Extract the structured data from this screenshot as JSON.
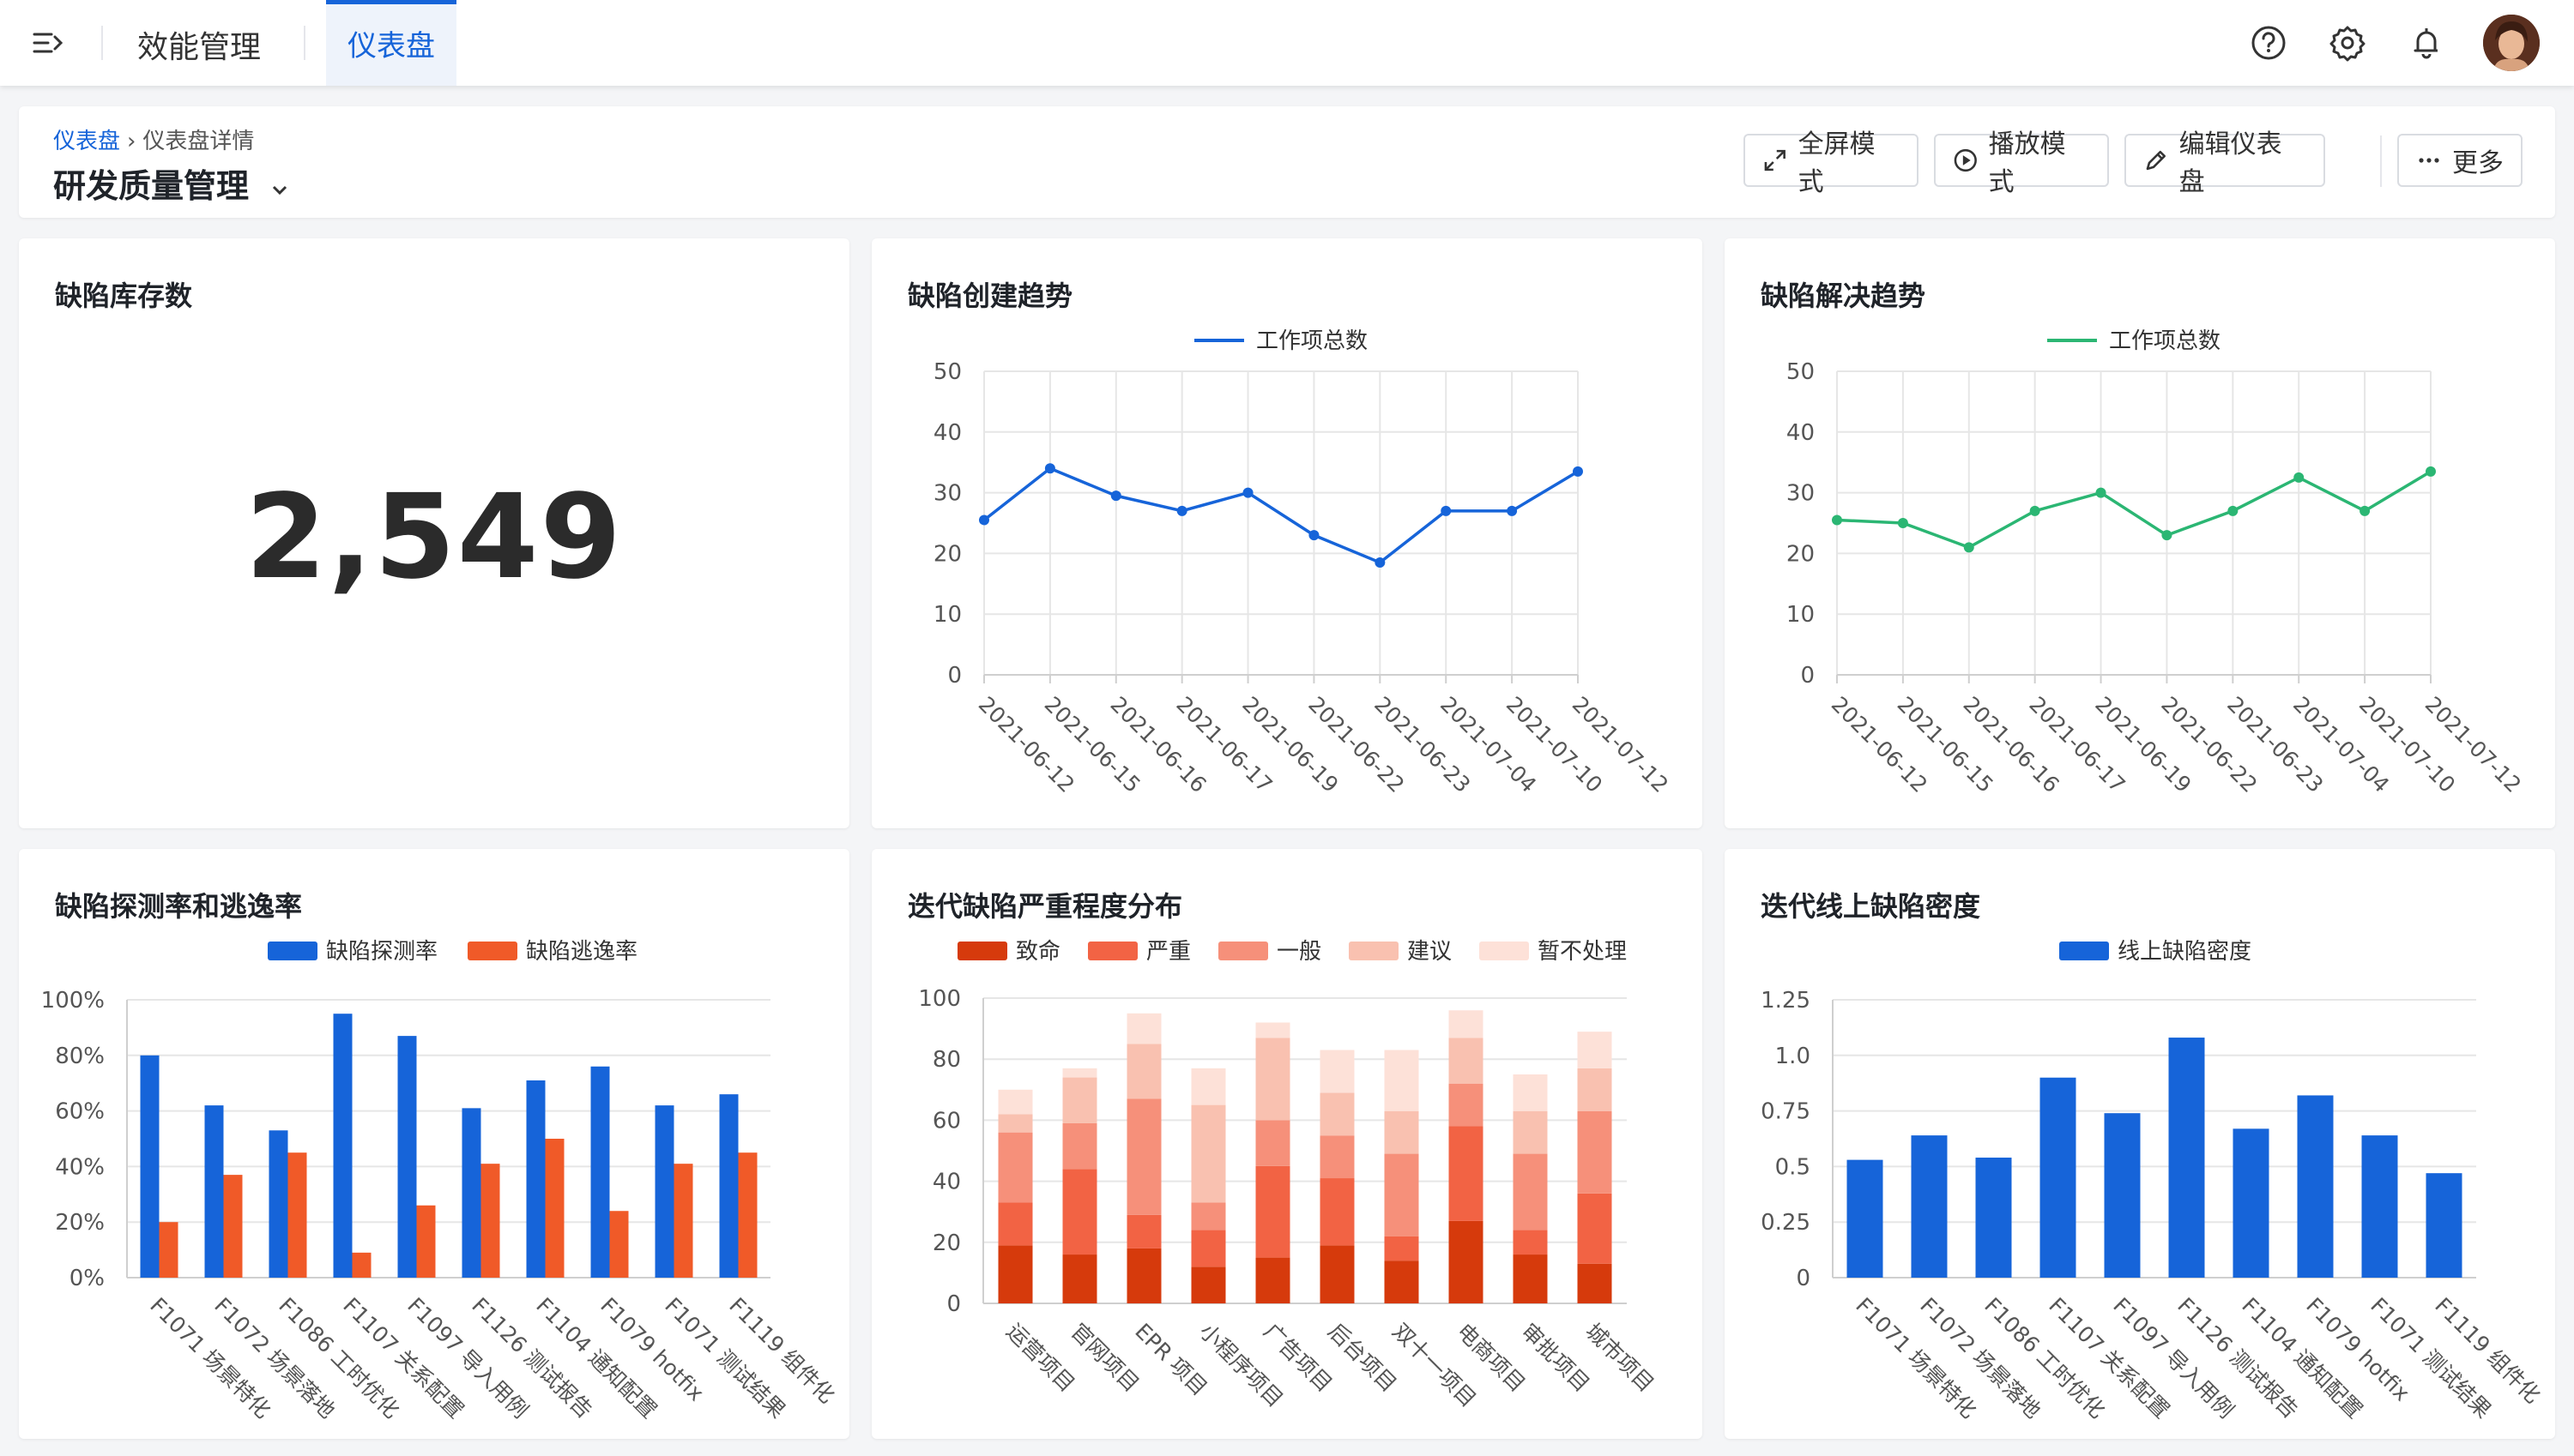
{
  "topbar": {
    "app_title": "效能管理",
    "tab_label": "仪表盘",
    "icons": [
      "menu-icon",
      "help-icon",
      "settings-icon",
      "bell-icon"
    ]
  },
  "header": {
    "breadcrumb_root": "仪表盘",
    "breadcrumb_current": "仪表盘详情",
    "title": "研发质量管理",
    "buttons": {
      "fullscreen": "全屏模式",
      "play": "播放模式",
      "edit": "编辑仪表盘",
      "more": "更多"
    }
  },
  "cards": {
    "inventory": {
      "title": "缺陷库存数",
      "value": "2,549"
    },
    "create_trend": {
      "title": "缺陷创建趋势"
    },
    "resolve_trend": {
      "title": "缺陷解决趋势"
    },
    "detect_rate": {
      "title": "缺陷探测率和逃逸率"
    },
    "severity": {
      "title": "迭代缺陷严重程度分布"
    },
    "density": {
      "title": "迭代线上缺陷密度"
    }
  },
  "colors": {
    "primary": "#1664d9",
    "green": "#2bb673",
    "escape": "#f05a28",
    "severity": [
      "#d63a0c",
      "#f26344",
      "#f6907a",
      "#f9c1b0",
      "#fde1d8"
    ]
  },
  "chart_data": [
    {
      "id": "create_trend",
      "type": "line",
      "x": [
        "2021-06-12",
        "2021-06-15",
        "2021-06-16",
        "2021-06-17",
        "2021-06-19",
        "2021-06-22",
        "2021-06-23",
        "2021-07-04",
        "2021-07-10",
        "2021-07-12"
      ],
      "series": [
        {
          "name": "工作项总数",
          "values": [
            25.5,
            34,
            29.5,
            27,
            30,
            23,
            18.5,
            27,
            27,
            33.5
          ],
          "color": "#1664d9"
        }
      ],
      "ylim": [
        0,
        50
      ],
      "yticks": [
        "0",
        "10",
        "20",
        "30",
        "40",
        "50"
      ],
      "legend": "top-center",
      "grid": true
    },
    {
      "id": "resolve_trend",
      "type": "line",
      "x": [
        "2021-06-12",
        "2021-06-15",
        "2021-06-16",
        "2021-06-17",
        "2021-06-19",
        "2021-06-22",
        "2021-06-23",
        "2021-07-04",
        "2021-07-10",
        "2021-07-12"
      ],
      "series": [
        {
          "name": "工作项总数",
          "values": [
            25.5,
            25,
            21,
            27,
            30,
            23,
            27,
            32.5,
            27,
            33.5
          ],
          "color": "#2bb673"
        }
      ],
      "ylim": [
        0,
        50
      ],
      "yticks": [
        "0",
        "10",
        "20",
        "30",
        "40",
        "50"
      ],
      "legend": "top-center",
      "grid": true
    },
    {
      "id": "detect_rate",
      "type": "bar",
      "categories": [
        "F1071 场景特化",
        "F1072 场景落地",
        "F1086 工时优化",
        "F1107 关系配置",
        "F1097 导入用例",
        "F1126 测试报告",
        "F1104 通知配置",
        "F1079 hotfix",
        "F1071 测试结果",
        "F1119 组件化"
      ],
      "series": [
        {
          "name": "缺陷探测率",
          "values": [
            80,
            62,
            53,
            95,
            87,
            61,
            71,
            76,
            62,
            66
          ],
          "color": "#1664d9"
        },
        {
          "name": "缺陷逃逸率",
          "values": [
            20,
            37,
            45,
            9,
            26,
            41,
            50,
            24,
            41,
            45
          ],
          "color": "#f05a28"
        }
      ],
      "ylim": [
        0,
        100
      ],
      "yticks": [
        "0%",
        "20%",
        "40%",
        "60%",
        "80%",
        "100%"
      ],
      "legend": "top-center",
      "grid": true
    },
    {
      "id": "severity",
      "type": "bar",
      "stacked": true,
      "categories": [
        "运营项目",
        "官网项目",
        "EPR 项目",
        "小程序项目",
        "广告项目",
        "后台项目",
        "双十一项目",
        "电商项目",
        "审批项目",
        "城市项目"
      ],
      "series": [
        {
          "name": "致命",
          "values": [
            19,
            16,
            18,
            12,
            15,
            19,
            14,
            27,
            16,
            13
          ]
        },
        {
          "name": "严重",
          "values": [
            14,
            28,
            11,
            12,
            30,
            22,
            8,
            31,
            8,
            23
          ]
        },
        {
          "name": "一般",
          "values": [
            23,
            15,
            38,
            9,
            15,
            14,
            27,
            14,
            25,
            27
          ]
        },
        {
          "name": "建议",
          "values": [
            6,
            15,
            18,
            32,
            27,
            14,
            14,
            15,
            14,
            14
          ]
        },
        {
          "name": "暂不处理",
          "values": [
            8,
            3,
            10,
            12,
            5,
            14,
            20,
            9,
            12,
            12
          ]
        }
      ],
      "ylim": [
        0,
        100
      ],
      "yticks": [
        "0",
        "20",
        "40",
        "60",
        "80",
        "100"
      ],
      "legend": "top-center",
      "grid": true
    },
    {
      "id": "density",
      "type": "bar",
      "categories": [
        "F1071 场景特化",
        "F1072 场景落地",
        "F1086 工时优化",
        "F1107 关系配置",
        "F1097 导入用例",
        "F1126 测试报告",
        "F1104 通知配置",
        "F1079 hotfix",
        "F1071 测试结果",
        "F1119 组件化"
      ],
      "series": [
        {
          "name": "线上缺陷密度",
          "values": [
            0.53,
            0.64,
            0.54,
            0.9,
            0.74,
            1.08,
            0.67,
            0.82,
            0.64,
            0.47
          ],
          "color": "#1664d9"
        }
      ],
      "ylim": [
        0,
        1.25
      ],
      "yticks": [
        "0",
        "0.25",
        "0.5",
        "0.75",
        "1.0",
        "1.25"
      ],
      "legend": "top-center",
      "grid": true
    }
  ]
}
